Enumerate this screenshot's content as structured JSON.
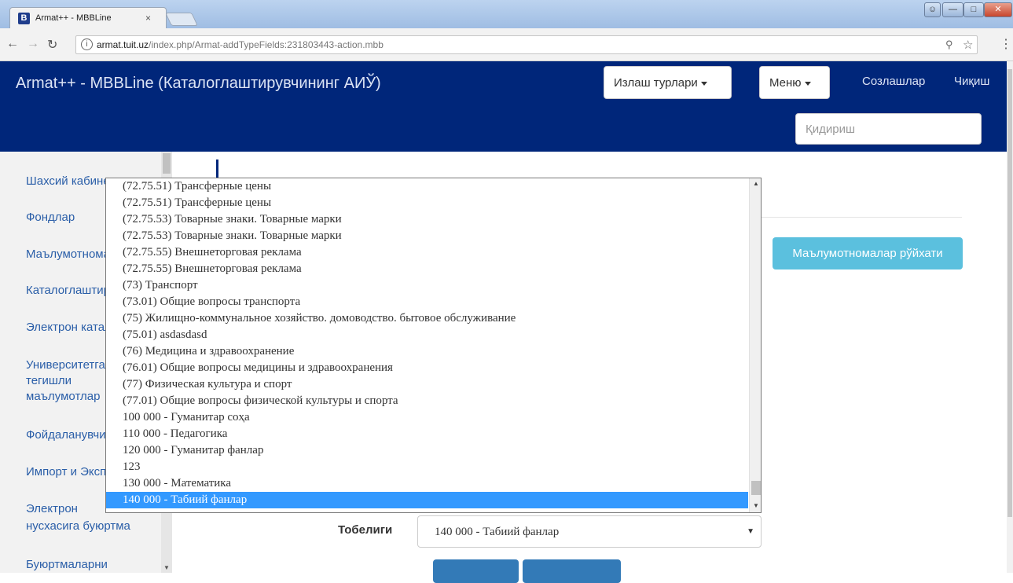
{
  "browser": {
    "tab_title": "Armat++ - MBBLine",
    "tab_favicon": "B",
    "tab_close": "×",
    "url_host": "armat.tuit.uz",
    "url_path": "/index.php/Armat-addTypeFields:231803443-action.mbb"
  },
  "navbar": {
    "brand": "Armat++ - MBBLine (Каталоглаштирувчининг АИЎ)",
    "izlash_label": "Излаш турлари",
    "menu_label": "Меню",
    "links_label": "Созлашлар",
    "logout_label": "Чиқиш",
    "search_placeholder": "Қидириш"
  },
  "sidebar": {
    "items": [
      "Шахсий кабинет",
      "Фондлар",
      "Маълумотномалар",
      "Каталоглаштириш",
      "Электрон каталог",
      "Университетга",
      "тегишли",
      "маълумотлар",
      "Фойдаланувчилар",
      "Импорт и Экспорт",
      "Электрон",
      "нусхасига буюртма",
      "Буюртмаларни"
    ]
  },
  "main": {
    "info_button": "Маълумотномалар рўйхати",
    "tobeligi_label": "Тобелиги",
    "tobeligi_value": "140 000 - Табиий фанлар"
  },
  "dropdown": {
    "options": [
      "(72.75.51) Трансферные цены",
      "(72.75.51) Трансферные цены",
      "(72.75.53) Товарные знаки. Товарные марки",
      "(72.75.53) Товарные знаки. Товарные марки",
      "(72.75.55) Внешнеторговая реклама",
      "(72.75.55) Внешнеторговая реклама",
      "(73) Транспорт",
      "(73.01) Общие вопросы транспорта",
      "(75) Жилищно-коммунальное хозяйство. домоводство. бытовое обслуживание",
      "(75.01) asdasdasd",
      "(76) Медицина и здравоохранение",
      "(76.01) Общие вопросы медицины и здравоохранения",
      "(77) Физическая культура и спорт",
      "(77.01) Общие вопросы физической культуры и спорта",
      "100 000 - Гуманитар соҳа",
      "110 000 - Педагогика",
      "120 000 - Гуманитар фанлар",
      "123",
      "130 000 - Математика",
      "140 000 - Табиий фанлар"
    ],
    "selected_index": 19
  },
  "colors": {
    "navbar_bg": "#00267a",
    "info_button_bg": "#5bc0de",
    "selected_option_bg": "#3399ff",
    "sidebar_link": "#2a5ea8"
  }
}
